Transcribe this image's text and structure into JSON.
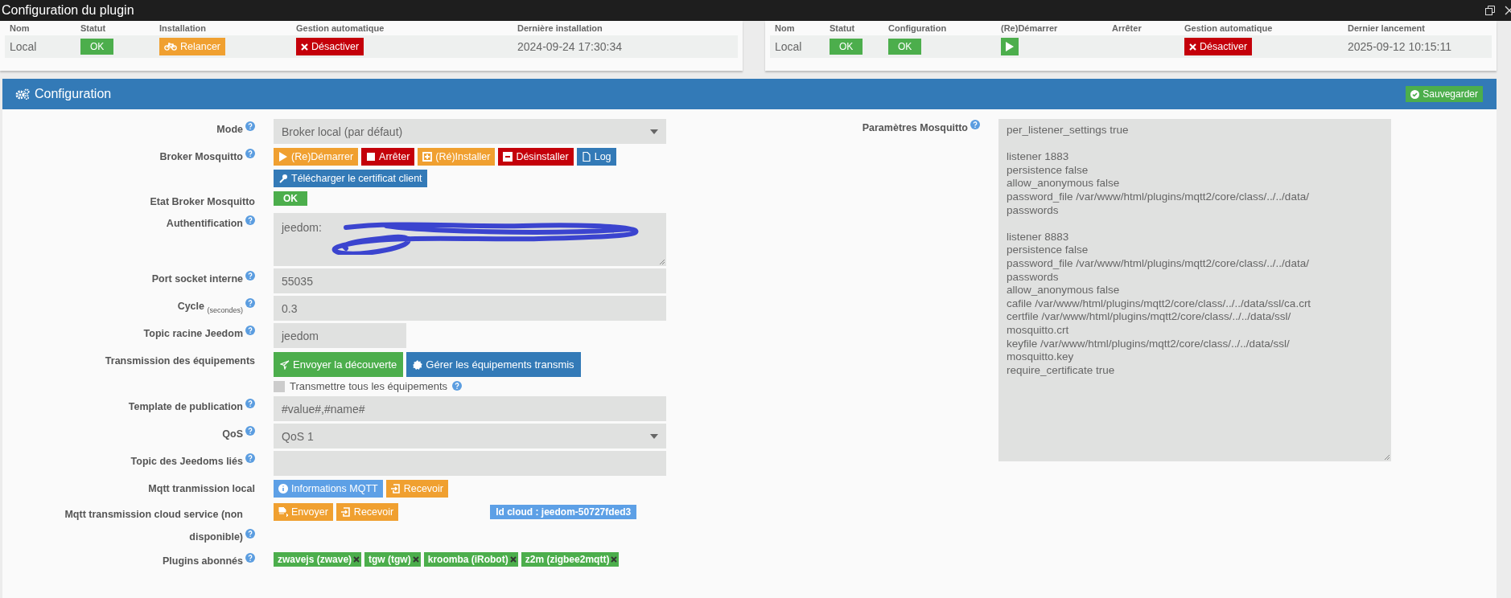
{
  "window": {
    "title": "Configuration du plugin"
  },
  "dependency_table": {
    "columns": [
      "Nom",
      "Statut",
      "Installation",
      "Gestion automatique",
      "Dernière installation"
    ],
    "cells": [
      {
        "kind": "text",
        "text": "Local"
      },
      {
        "kind": "status",
        "text": "OK"
      },
      {
        "kind": "button",
        "text": "Relancer"
      },
      {
        "kind": "button",
        "text": "Désactiver"
      },
      {
        "kind": "text",
        "text": "2024-09-24 17:30:34"
      }
    ]
  },
  "daemon_table": {
    "columns": [
      "Nom",
      "Statut",
      "Configuration",
      "(Re)Démarrer",
      "Arrêter",
      "Gestion automatique",
      "Dernier lancement"
    ],
    "cells": [
      {
        "kind": "text",
        "text": "Local"
      },
      {
        "kind": "status",
        "text": "OK"
      },
      {
        "kind": "status",
        "text": "OK"
      },
      {
        "kind": "play"
      },
      {
        "kind": "empty"
      },
      {
        "kind": "button",
        "text": "Désactiver"
      },
      {
        "kind": "text",
        "text": "2025-09-12 10:15:11"
      }
    ]
  },
  "config": {
    "title": "Configuration",
    "save_button": "Sauvegarder",
    "fields": [
      {
        "kind": "select",
        "label": "Mode",
        "help": true,
        "value": "Broker local (par défaut)"
      },
      {
        "kind": "buttons",
        "label": "Broker Mosquitto",
        "help": true,
        "buttons": [
          "(Re)Démarrer",
          "Arrêter",
          "(Ré)Installer",
          "Désinstaller",
          "Log",
          "Télécharger le certificat client"
        ]
      },
      {
        "kind": "status",
        "label": "Etat Broker Mosquitto",
        "help": false,
        "value": "OK"
      },
      {
        "kind": "textarea",
        "label": "Authentification",
        "help": true,
        "value": "jeedom:",
        "redacted": true
      },
      {
        "kind": "input",
        "label": "Port socket interne",
        "help": true,
        "value": "55035"
      },
      {
        "kind": "input",
        "label": "Cycle $_{(secondes)}$",
        "help": true,
        "value": "0.3"
      },
      {
        "kind": "short-input",
        "label": "Topic racine Jeedom",
        "help": true,
        "value": "jeedom"
      },
      {
        "kind": "buttons",
        "label": "Transmission des équipements",
        "help": false,
        "buttons": [
          "Envoyer la découverte",
          "Gérer les équipements transmis"
        ],
        "checkbox": {
          "label": "Transmettre tous les équipements",
          "checked": false,
          "help": true
        }
      },
      {
        "kind": "input",
        "label": "Template de publication",
        "help": true,
        "value": "#value#,#name#"
      },
      {
        "kind": "select",
        "label": "QoS",
        "help": true,
        "value": "QoS 1"
      },
      {
        "kind": "input",
        "label": "Topic des Jeedoms liés",
        "help": true
      },
      {
        "kind": "buttons",
        "label": "Mqtt tranmission local",
        "help": false,
        "buttons": [
          "Informations MQTT",
          "Recevoir"
        ]
      },
      {
        "kind": "buttons",
        "label": "Mqtt transmission cloud service (non disponible)",
        "help": true,
        "buttons": [
          "Envoyer",
          "Recevoir"
        ],
        "badge": "Id cloud : jeedom-50727fded3"
      },
      {
        "kind": "tags",
        "label": "Plugins abonnés",
        "help": true,
        "tags": [
          "zwavejs (zwave)",
          "tgw (tgw)",
          "kroomba (iRobot)",
          "z2m (zigbee2mqtt)"
        ]
      }
    ],
    "mosquitto": {
      "label": "Paramètres Mosquitto",
      "help": true,
      "blocks": [
        [
          "per_listener_settings true"
        ],
        [
          "listener 1883",
          "persistence false",
          "allow_anonymous false",
          "password_file /var/www/html/plugins/mqtt2/core/class/../../data/",
          "passwords"
        ],
        [
          "listener 8883",
          "persistence false",
          "password_file /var/www/html/plugins/mqtt2/core/class/../../data/",
          "passwords",
          "allow_anonymous false",
          "cafile /var/www/html/plugins/mqtt2/core/class/../../data/ssl/ca.crt",
          "certfile /var/www/html/plugins/mqtt2/core/class/../../data/ssl/",
          "mosquitto.crt",
          "keyfile /var/www/html/plugins/mqtt2/core/class/../../data/ssl/",
          "mosquitto.key",
          "require_certificate true"
        ]
      ]
    }
  }
}
